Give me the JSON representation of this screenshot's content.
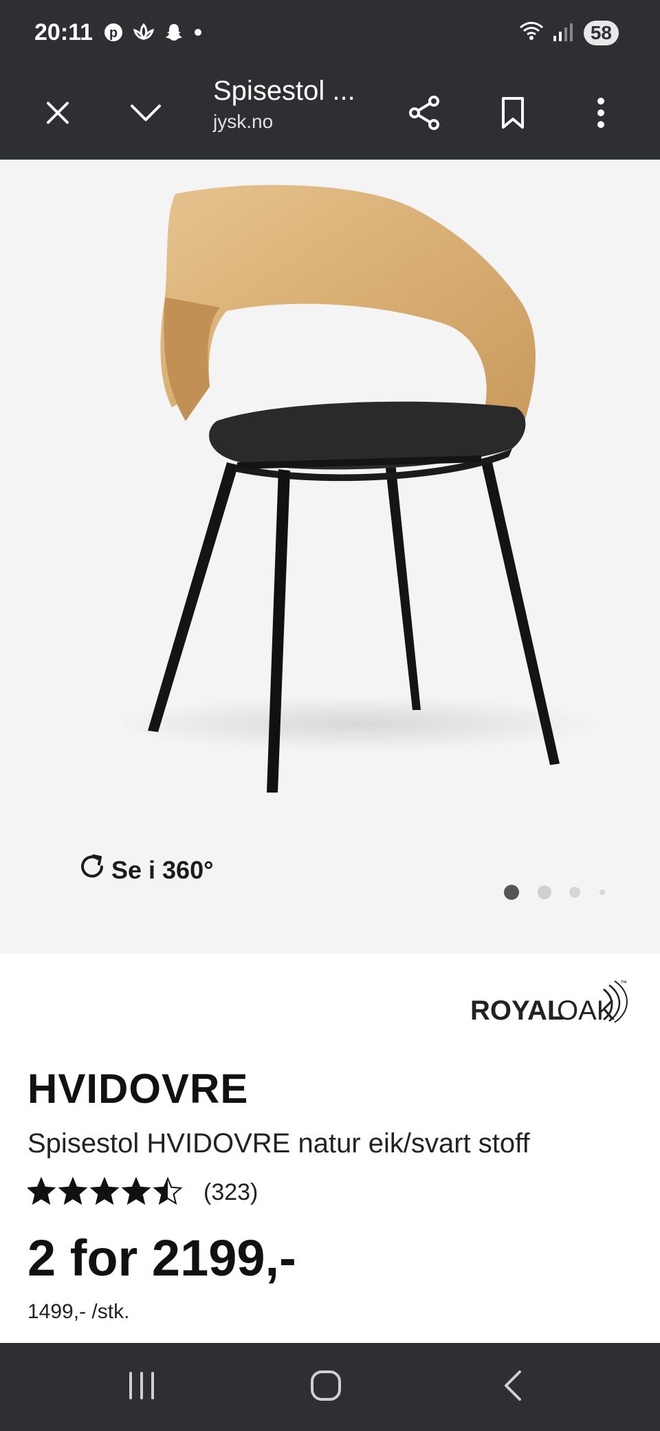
{
  "status_bar": {
    "time": "20:11",
    "battery": "58",
    "icons_left": [
      "pinterest-icon",
      "lotus-icon",
      "snapchat-icon",
      "dot-icon"
    ],
    "icons_right": [
      "wifi-icon",
      "signal-icon"
    ]
  },
  "toolbar": {
    "title": "Spisestol ...",
    "domain": "jysk.no",
    "icons": [
      "close-icon",
      "chevron-down-icon",
      "share-icon",
      "bookmark-icon",
      "more-vertical-icon"
    ]
  },
  "hero": {
    "view360_label": "Se i 360°",
    "carousel": {
      "total": 4,
      "active_index": 0
    }
  },
  "brand": {
    "logo_text_bold": "ROYAL",
    "logo_text_light": "OAK",
    "trademark": "™"
  },
  "product": {
    "name": "HVIDOVRE",
    "subtitle": "Spisestol HVIDOVRE natur eik/svart stoff",
    "rating": 4.5,
    "rating_max": 5,
    "reviews": "(323)",
    "price": "2 for 2199,-",
    "unit_price": "1499,- /stk."
  },
  "nav": {
    "icons": [
      "recent-apps-icon",
      "home-icon",
      "back-icon"
    ]
  },
  "colors": {
    "bar_background": "#2e2f33",
    "hero_background": "#f4f4f4",
    "text_primary": "#111111"
  }
}
